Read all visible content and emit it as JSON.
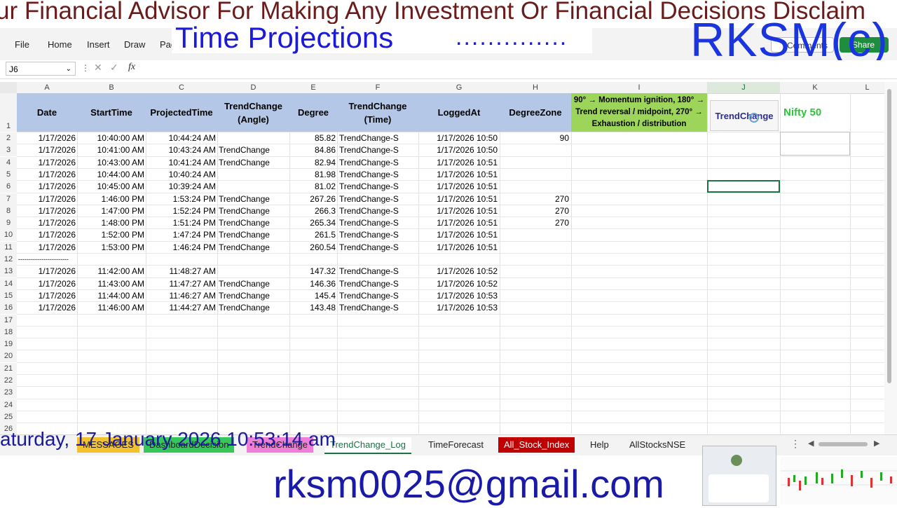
{
  "banner_text": "ur Financial Advisor For Making Any Investment Or Financial Decisions Disclaim",
  "overlay": {
    "title": "Time Projections",
    "dots": "..............",
    "brand": "RKSM(c)",
    "datetime": "aturday, 17 January 2026  10:53:14 am",
    "email": "rksm0025@gmail.com"
  },
  "ribbon": {
    "menus": [
      "File",
      "Home",
      "Insert",
      "Draw",
      "Pag"
    ],
    "comments": "Comments",
    "share": "Share"
  },
  "formula_bar": {
    "name_box": "J6",
    "fx": "fx"
  },
  "columns": [
    "A",
    "B",
    "C",
    "D",
    "E",
    "F",
    "G",
    "H",
    "I",
    "J",
    "K",
    "L"
  ],
  "headers": {
    "A": "Date",
    "B": "StartTime",
    "C": "ProjectedTime",
    "D": "TrendChange (Angle)",
    "E": "Degree",
    "F": "TrendChange (Time)",
    "G": "LoggedAt",
    "H": "DegreeZone"
  },
  "note": "90° → Momentum ignition, 180° → Trend reversal / midpoint, 270° → Exhaustion / distribution",
  "trend_button": "TrendChange",
  "nifty_label": "Nifty 50",
  "rows": [
    {
      "n": "2",
      "date": "1/17/2026",
      "start": "10:40:00 AM",
      "proj": "10:44:24 AM",
      "angle": "",
      "degree": "85.82",
      "time": "TrendChange-S",
      "logged": "1/17/2026 10:50",
      "zone": "90"
    },
    {
      "n": "3",
      "date": "1/17/2026",
      "start": "10:41:00 AM",
      "proj": "10:43:24 AM",
      "angle": "TrendChange",
      "degree": "84.86",
      "time": "TrendChange-S",
      "logged": "1/17/2026 10:50",
      "zone": ""
    },
    {
      "n": "4",
      "date": "1/17/2026",
      "start": "10:43:00 AM",
      "proj": "10:41:24 AM",
      "angle": "TrendChange",
      "degree": "82.94",
      "time": "TrendChange-S",
      "logged": "1/17/2026 10:51",
      "zone": ""
    },
    {
      "n": "5",
      "date": "1/17/2026",
      "start": "10:44:00 AM",
      "proj": "10:40:24 AM",
      "angle": "",
      "degree": "81.98",
      "time": "TrendChange-S",
      "logged": "1/17/2026 10:51",
      "zone": ""
    },
    {
      "n": "6",
      "date": "1/17/2026",
      "start": "10:45:00 AM",
      "proj": "10:39:24 AM",
      "angle": "",
      "degree": "81.02",
      "time": "TrendChange-S",
      "logged": "1/17/2026 10:51",
      "zone": ""
    },
    {
      "n": "7",
      "date": "1/17/2026",
      "start": "1:46:00 PM",
      "proj": "1:53:24 PM",
      "angle": "TrendChange",
      "degree": "267.26",
      "time": "TrendChange-S",
      "logged": "1/17/2026 10:51",
      "zone": "270"
    },
    {
      "n": "8",
      "date": "1/17/2026",
      "start": "1:47:00 PM",
      "proj": "1:52:24 PM",
      "angle": "TrendChange",
      "degree": "266.3",
      "time": "TrendChange-S",
      "logged": "1/17/2026 10:51",
      "zone": "270"
    },
    {
      "n": "9",
      "date": "1/17/2026",
      "start": "1:48:00 PM",
      "proj": "1:51:24 PM",
      "angle": "TrendChange",
      "degree": "265.34",
      "time": "TrendChange-S",
      "logged": "1/17/2026 10:51",
      "zone": "270"
    },
    {
      "n": "10",
      "date": "1/17/2026",
      "start": "1:52:00 PM",
      "proj": "1:47:24 PM",
      "angle": "TrendChange",
      "degree": "261.5",
      "time": "TrendChange-S",
      "logged": "1/17/2026 10:51",
      "zone": ""
    },
    {
      "n": "11",
      "date": "1/17/2026",
      "start": "1:53:00 PM",
      "proj": "1:46:24 PM",
      "angle": "TrendChange",
      "degree": "260.54",
      "time": "TrendChange-S",
      "logged": "1/17/2026 10:51",
      "zone": ""
    },
    {
      "n": "12",
      "date": "------------------------",
      "start": "",
      "proj": "",
      "angle": "",
      "degree": "",
      "time": "",
      "logged": "",
      "zone": ""
    },
    {
      "n": "13",
      "date": "1/17/2026",
      "start": "11:42:00 AM",
      "proj": "11:48:27 AM",
      "angle": "",
      "degree": "147.32",
      "time": "TrendChange-S",
      "logged": "1/17/2026 10:52",
      "zone": ""
    },
    {
      "n": "14",
      "date": "1/17/2026",
      "start": "11:43:00 AM",
      "proj": "11:47:27 AM",
      "angle": "TrendChange",
      "degree": "146.36",
      "time": "TrendChange-S",
      "logged": "1/17/2026 10:52",
      "zone": ""
    },
    {
      "n": "15",
      "date": "1/17/2026",
      "start": "11:44:00 AM",
      "proj": "11:46:27 AM",
      "angle": "TrendChange",
      "degree": "145.4",
      "time": "TrendChange-S",
      "logged": "1/17/2026 10:53",
      "zone": ""
    },
    {
      "n": "16",
      "date": "1/17/2026",
      "start": "11:46:00 AM",
      "proj": "11:44:27 AM",
      "angle": "TrendChange",
      "degree": "143.48",
      "time": "TrendChange-S",
      "logged": "1/17/2026 10:53",
      "zone": ""
    }
  ],
  "empty_rows": [
    "17",
    "18",
    "19",
    "20",
    "21",
    "22",
    "23",
    "24",
    "25",
    "26"
  ],
  "tabs": [
    {
      "label": "MESSAGES",
      "bg": "#f2c12e",
      "color": "#222"
    },
    {
      "label": "DashboardDecision",
      "bg": "#34c759",
      "color": "#222"
    },
    {
      "label": "TrendChange",
      "bg": "#ef7fd6",
      "color": "#222"
    },
    {
      "label": "TrendChange_Log",
      "bg": "#ffffff",
      "color": "#1e7145"
    },
    {
      "label": "TimeForecast",
      "bg": "transparent",
      "color": "#222"
    },
    {
      "label": "All_Stock_Index",
      "bg": "#c00000",
      "color": "#ffffff"
    },
    {
      "label": "Help",
      "bg": "transparent",
      "color": "#222"
    },
    {
      "label": "AllStocksNSE",
      "bg": "transparent",
      "color": "#222"
    }
  ]
}
